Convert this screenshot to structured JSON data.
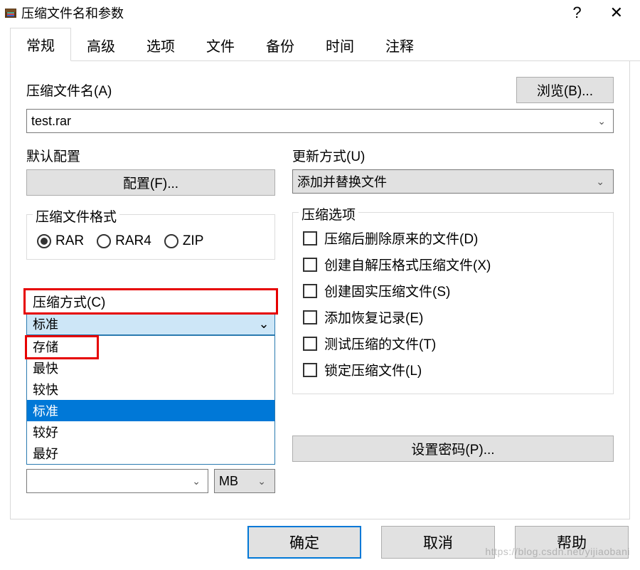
{
  "titlebar": {
    "title": "压缩文件名和参数",
    "help_glyph": "?",
    "close_glyph": "✕"
  },
  "tabs": [
    "常规",
    "高级",
    "选项",
    "文件",
    "备份",
    "时间",
    "注释"
  ],
  "filename": {
    "label": "压缩文件名(A)",
    "value": "test.rar",
    "browse_btn": "浏览(B)..."
  },
  "default_profile": {
    "label": "默认配置",
    "btn": "配置(F)..."
  },
  "update_mode": {
    "label": "更新方式(U)",
    "value": "添加并替换文件"
  },
  "format": {
    "legend": "压缩文件格式",
    "options": [
      "RAR",
      "RAR4",
      "ZIP"
    ],
    "selected": "RAR"
  },
  "method": {
    "label": "压缩方式(C)",
    "selected": "标准",
    "options": [
      "存储",
      "最快",
      "较快",
      "标准",
      "较好",
      "最好"
    ]
  },
  "split": {
    "unit": "MB"
  },
  "options": {
    "legend": "压缩选项",
    "items": [
      "压缩后删除原来的文件(D)",
      "创建自解压格式压缩文件(X)",
      "创建固实压缩文件(S)",
      "添加恢复记录(E)",
      "测试压缩的文件(T)",
      "锁定压缩文件(L)"
    ]
  },
  "password_btn": "设置密码(P)...",
  "dlg": {
    "ok": "确定",
    "cancel": "取消",
    "help": "帮助"
  },
  "watermark": "https://blog.csdn.net/yijiaobani"
}
